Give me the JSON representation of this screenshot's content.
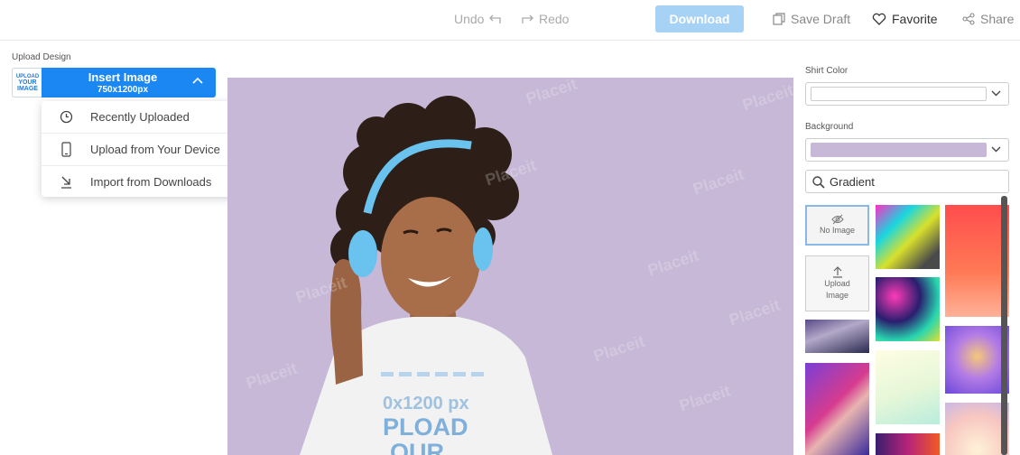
{
  "toolbar": {
    "undo": "Undo",
    "redo": "Redo",
    "download": "Download",
    "save_draft": "Save Draft",
    "favorite": "Favorite",
    "share": "Share"
  },
  "upload": {
    "section_label": "Upload Design",
    "thumb_lines": [
      "UPLOAD",
      "YOUR",
      "IMAGE"
    ],
    "insert_title": "Insert Image",
    "insert_size": "750x1200px",
    "menu": [
      {
        "label": "Recently Uploaded",
        "icon": "clock-icon"
      },
      {
        "label": "Upload from Your Device",
        "icon": "phone-icon"
      },
      {
        "label": "Import from Downloads",
        "icon": "download-arrow-icon"
      }
    ]
  },
  "canvas": {
    "watermark": "Placeit",
    "background_color": "#c7b8d7",
    "shirt_print_lines": [
      "0x1200 px",
      "PLOAD",
      "OUR"
    ]
  },
  "sidebar": {
    "shirt_color_label": "Shirt Color",
    "shirt_color_value": "#ffffff",
    "background_label": "Background",
    "background_value": "#c7b8d7",
    "search_value": "Gradient",
    "no_image": "No Image",
    "upload_image_lines": [
      "Upload",
      "Image"
    ]
  },
  "colors": {
    "accent": "#1a87f2",
    "download_disabled": "#a6d2f6"
  }
}
